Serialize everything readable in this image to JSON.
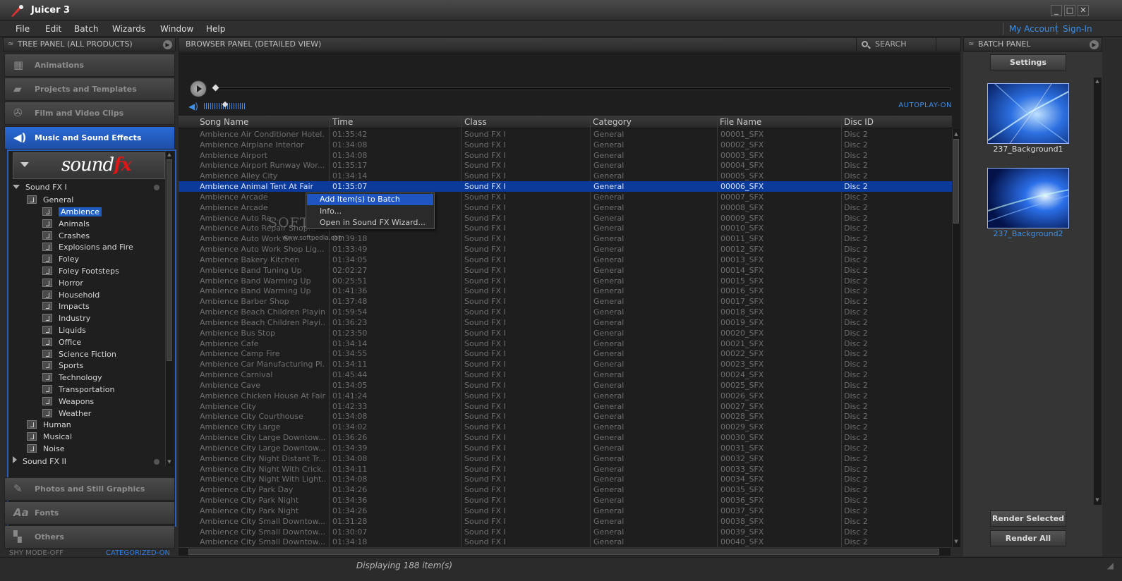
{
  "app": {
    "title": "Juicer 3"
  },
  "window_controls": {
    "minimize": "_",
    "maximize": "□",
    "close": "✕"
  },
  "menu": [
    "File",
    "Edit",
    "Batch",
    "Wizards",
    "Window",
    "Help"
  ],
  "account": {
    "my_account": "My Account",
    "sign_in": "Sign-In"
  },
  "tree_panel": {
    "title": "TREE PANEL (ALL PRODUCTS)",
    "categories": [
      {
        "label": "Animations",
        "icon": "film-strip-icon"
      },
      {
        "label": "Projects and Templates",
        "icon": "book-icon"
      },
      {
        "label": "Film and Video Clips",
        "icon": "film-reel-icon"
      },
      {
        "label": "Music and Sound Effects",
        "icon": "speaker-icon"
      },
      {
        "label": "Photos and Still Graphics",
        "icon": "paint-palette-icon"
      },
      {
        "label": "Fonts",
        "icon": "font-icon"
      },
      {
        "label": "Others",
        "icon": "puzzle-icon"
      }
    ],
    "logo": {
      "text": "sound",
      "fx": "fx"
    },
    "tree": {
      "root1": "Sound FX I",
      "general": "General",
      "general_children": [
        "Ambience",
        "Animals",
        "Crashes",
        "Explosions and Fire",
        "Foley",
        "Foley Footsteps",
        "Horror",
        "Household",
        "Impacts",
        "Industry",
        "Liquids",
        "Office",
        "Science Fiction",
        "Sports",
        "Technology",
        "Transportation",
        "Weapons",
        "Weather"
      ],
      "siblings": [
        "Human",
        "Musical",
        "Noise"
      ],
      "root2": "Sound FX II"
    },
    "shy_mode": "SHY MODE-OFF",
    "categorized": "CATEGORIZED-ON"
  },
  "browser": {
    "title": "BROWSER PANEL (DETAILED VIEW)",
    "search": "SEARCH",
    "autoplay": "AUTOPLAY-ON",
    "columns": [
      "Song Name",
      "Time",
      "Class",
      "Category",
      "File Name",
      "Disc ID"
    ],
    "selected_row": 5,
    "rows": [
      [
        "Ambience Air Conditioner Hotel...",
        "01:35:42",
        "Sound FX I",
        "General",
        "00001_SFX",
        "Disc 2"
      ],
      [
        "Ambience Airplane Interior",
        "01:34:08",
        "Sound FX I",
        "General",
        "00002_SFX",
        "Disc 2"
      ],
      [
        "Ambience Airport",
        "01:34:08",
        "Sound FX I",
        "General",
        "00003_SFX",
        "Disc 2"
      ],
      [
        "Ambience Airport Runway Wor...",
        "01:35:17",
        "Sound FX I",
        "General",
        "00004_SFX",
        "Disc 2"
      ],
      [
        "Ambience Alley City",
        "01:34:14",
        "Sound FX I",
        "General",
        "00005_SFX",
        "Disc 2"
      ],
      [
        "Ambience Animal Tent At Fair",
        "01:35:07",
        "Sound FX I",
        "General",
        "00006_SFX",
        "Disc 2"
      ],
      [
        "Ambience Arcade",
        "",
        "Sound FX I",
        "General",
        "00007_SFX",
        "Disc 2"
      ],
      [
        "Ambience Arcade",
        "",
        "Sound FX I",
        "General",
        "00008_SFX",
        "Disc 2"
      ],
      [
        "Ambience Auto Re...",
        "",
        "Sound FX I",
        "General",
        "00009_SFX",
        "Disc 2"
      ],
      [
        "Ambience Auto Repair Shop...",
        "",
        "Sound FX I",
        "General",
        "00010_SFX",
        "Disc 2"
      ],
      [
        "Ambience Auto Work S...",
        "01:39:18",
        "Sound FX I",
        "General",
        "00011_SFX",
        "Disc 2"
      ],
      [
        "Ambience Auto Work Shop Lig...",
        "01:33:49",
        "Sound FX I",
        "General",
        "00012_SFX",
        "Disc 2"
      ],
      [
        "Ambience Bakery Kitchen",
        "01:34:05",
        "Sound FX I",
        "General",
        "00013_SFX",
        "Disc 2"
      ],
      [
        "Ambience Band Tuning Up",
        "02:02:27",
        "Sound FX I",
        "General",
        "00014_SFX",
        "Disc 2"
      ],
      [
        "Ambience Band Warming Up",
        "00:25:51",
        "Sound FX I",
        "General",
        "00015_SFX",
        "Disc 2"
      ],
      [
        "Ambience Band Warming Up",
        "01:41:36",
        "Sound FX I",
        "General",
        "00016_SFX",
        "Disc 2"
      ],
      [
        "Ambience Barber Shop",
        "01:37:48",
        "Sound FX I",
        "General",
        "00017_SFX",
        "Disc 2"
      ],
      [
        "Ambience Beach Children Playing",
        "01:59:54",
        "Sound FX I",
        "General",
        "00018_SFX",
        "Disc 2"
      ],
      [
        "Ambience Beach Children Playi...",
        "01:36:23",
        "Sound FX I",
        "General",
        "00019_SFX",
        "Disc 2"
      ],
      [
        "Ambience Bus Stop",
        "01:23:50",
        "Sound FX I",
        "General",
        "00020_SFX",
        "Disc 2"
      ],
      [
        "Ambience Cafe",
        "01:34:14",
        "Sound FX I",
        "General",
        "00021_SFX",
        "Disc 2"
      ],
      [
        "Ambience Camp Fire",
        "01:34:55",
        "Sound FX I",
        "General",
        "00022_SFX",
        "Disc 2"
      ],
      [
        "Ambience Car Manufacturing Pl...",
        "01:34:11",
        "Sound FX I",
        "General",
        "00023_SFX",
        "Disc 2"
      ],
      [
        "Ambience Carnival",
        "01:45:44",
        "Sound FX I",
        "General",
        "00024_SFX",
        "Disc 2"
      ],
      [
        "Ambience Cave",
        "01:34:05",
        "Sound FX I",
        "General",
        "00025_SFX",
        "Disc 2"
      ],
      [
        "Ambience Chicken House At Fair",
        "01:41:24",
        "Sound FX I",
        "General",
        "00026_SFX",
        "Disc 2"
      ],
      [
        "Ambience City",
        "01:42:33",
        "Sound FX I",
        "General",
        "00027_SFX",
        "Disc 2"
      ],
      [
        "Ambience City Courthouse",
        "01:34:08",
        "Sound FX I",
        "General",
        "00028_SFX",
        "Disc 2"
      ],
      [
        "Ambience City Large",
        "01:34:02",
        "Sound FX I",
        "General",
        "00029_SFX",
        "Disc 2"
      ],
      [
        "Ambience City Large Downtow...",
        "01:36:26",
        "Sound FX I",
        "General",
        "00030_SFX",
        "Disc 2"
      ],
      [
        "Ambience City Large Downtow...",
        "01:34:39",
        "Sound FX I",
        "General",
        "00031_SFX",
        "Disc 2"
      ],
      [
        "Ambience City Night Distant Tr...",
        "01:34:08",
        "Sound FX I",
        "General",
        "00032_SFX",
        "Disc 2"
      ],
      [
        "Ambience City Night With Crick...",
        "01:34:11",
        "Sound FX I",
        "General",
        "00033_SFX",
        "Disc 2"
      ],
      [
        "Ambience City Night With Light...",
        "01:34:08",
        "Sound FX I",
        "General",
        "00034_SFX",
        "Disc 2"
      ],
      [
        "Ambience City Park Day",
        "01:34:26",
        "Sound FX I",
        "General",
        "00035_SFX",
        "Disc 2"
      ],
      [
        "Ambience City Park Night",
        "01:34:36",
        "Sound FX I",
        "General",
        "00036_SFX",
        "Disc 2"
      ],
      [
        "Ambience City Park Night",
        "01:34:26",
        "Sound FX I",
        "General",
        "00037_SFX",
        "Disc 2"
      ],
      [
        "Ambience City Small Downtow...",
        "01:31:28",
        "Sound FX I",
        "General",
        "00038_SFX",
        "Disc 2"
      ],
      [
        "Ambience City Small Downtow...",
        "01:30:07",
        "Sound FX I",
        "General",
        "00039_SFX",
        "Disc 2"
      ],
      [
        "Ambience City Small Downtow...",
        "01:34:18",
        "Sound FX I",
        "General",
        "00040_SFX",
        "Disc 2"
      ]
    ],
    "context_menu": [
      "Add Item(s) to Batch",
      "Info...",
      "Open in Sound FX Wizard..."
    ],
    "watermark": "SOFTPEDIA",
    "watermark_tm": "™",
    "watermark_url": "www.softpedia.com",
    "status": "Displaying 188 item(s)"
  },
  "batch_panel": {
    "title": "BATCH PANEL",
    "settings": "Settings",
    "items": [
      {
        "label": "237_Background1"
      },
      {
        "label": "237_Background2"
      }
    ],
    "render_selected": "Render Selected",
    "render_all": "Render All"
  },
  "colors": {
    "accent": "#1f5dc4",
    "link": "#3d8fe8",
    "selected_row": "#0b3a9a",
    "fx_red": "#e01515"
  }
}
